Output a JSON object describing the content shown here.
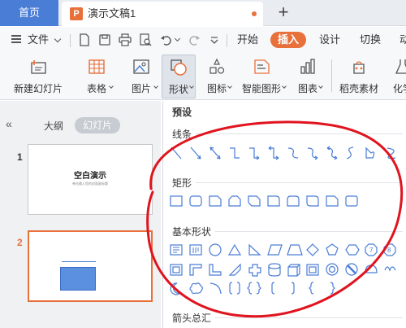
{
  "tabs": {
    "home": "首页",
    "doc_title": "演示文稿1",
    "doc_icon": "P",
    "new_tab": "+"
  },
  "menu": {
    "file": "文件",
    "tabs": [
      "开始",
      "插入",
      "设计",
      "切换",
      "动"
    ]
  },
  "ribbon": {
    "items": [
      {
        "label": "新建幻灯片",
        "icon": "new-slide-icon"
      },
      {
        "label": "表格",
        "icon": "table-icon"
      },
      {
        "label": "图片",
        "icon": "picture-icon"
      },
      {
        "label": "形状",
        "icon": "shape-icon"
      },
      {
        "label": "图标",
        "icon": "icons-icon"
      },
      {
        "label": "智能图形",
        "icon": "smart-art-icon"
      },
      {
        "label": "图表",
        "icon": "chart-icon"
      },
      {
        "label": "稻壳素材",
        "icon": "assets-icon"
      },
      {
        "label": "化学",
        "icon": "chemistry-icon"
      }
    ]
  },
  "panel": {
    "outline": "大纲",
    "slides": "幻灯片",
    "slide1_num": "1",
    "slide2_num": "2",
    "slide1_title": "空白演示",
    "slide1_subtitle": "单击输入您的封面副标题"
  },
  "shapes": {
    "header": "预设",
    "sections": [
      "线条",
      "矩形",
      "基本形状",
      "箭头总汇"
    ]
  },
  "colors": {
    "accent": "#e8703a",
    "home_tab": "#4a7dd6",
    "annotation": "#e0141e",
    "shape_stroke": "#4a7dd6"
  }
}
